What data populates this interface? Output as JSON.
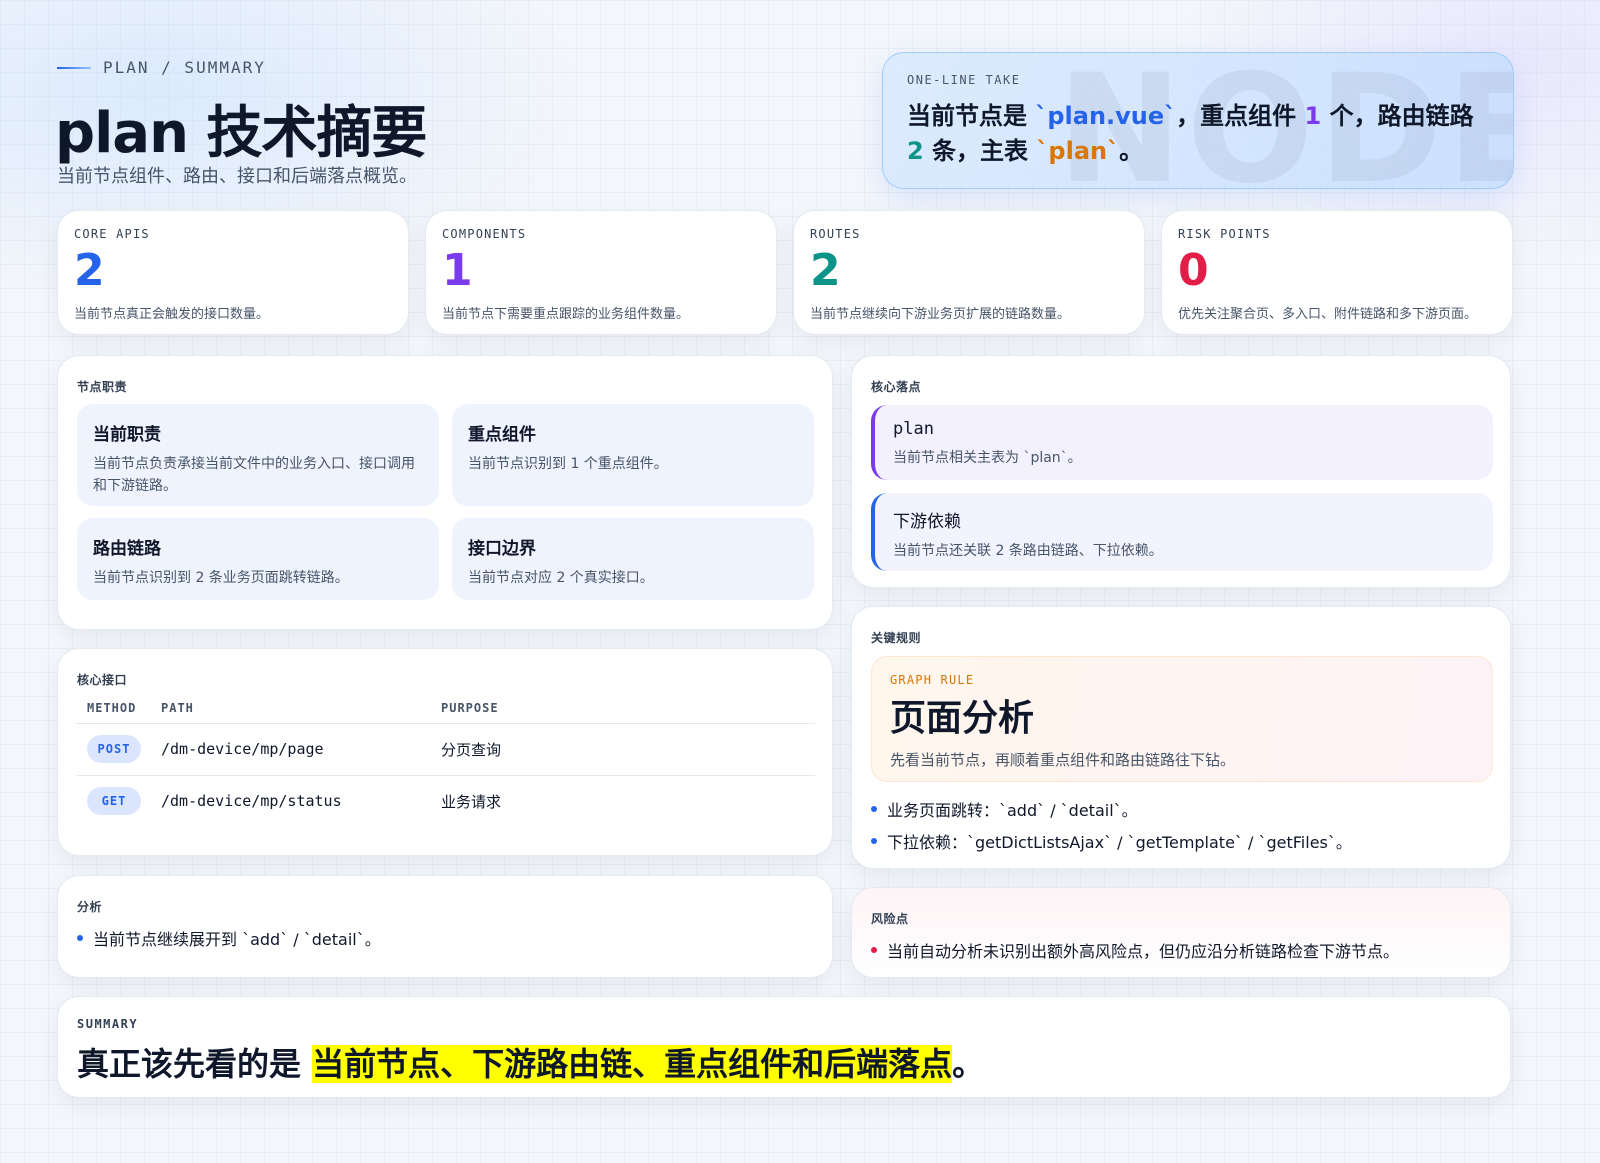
{
  "header": {
    "breadcrumb": "PLAN / SUMMARY",
    "title": "plan 技术摘要",
    "subtitle": "当前节点组件、路由、接口和后端落点概览。"
  },
  "take": {
    "label": "ONE-LINE TAKE",
    "watermark": "NODE",
    "parts": [
      "当前节点是 ",
      "`plan.vue`",
      "，重点组件 ",
      "1",
      " 个，路由链路 ",
      "2",
      " 条，主表 ",
      "`plan`",
      "。"
    ]
  },
  "stats": [
    {
      "label": "CORE APIS",
      "value": "2",
      "desc": "当前节点真正会触发的接口数量。",
      "color": "#2563eb"
    },
    {
      "label": "COMPONENTS",
      "value": "1",
      "desc": "当前节点下需要重点跟踪的业务组件数量。",
      "color": "#7c3aed"
    },
    {
      "label": "ROUTES",
      "value": "2",
      "desc": "当前节点继续向下游业务页扩展的链路数量。",
      "color": "#0d9488"
    },
    {
      "label": "RISK POINTS",
      "value": "0",
      "desc": "优先关注聚合页、多入口、附件链路和多下游页面。",
      "color": "#e11d48"
    }
  ],
  "duties": {
    "label": "节点职责",
    "items": [
      {
        "title": "当前职责",
        "desc": "当前节点负责承接当前文件中的业务入口、接口调用和下游链路。"
      },
      {
        "title": "重点组件",
        "desc": "当前节点识别到 1 个重点组件。"
      },
      {
        "title": "路由链路",
        "desc": "当前节点识别到 2 条业务页面跳转链路。"
      },
      {
        "title": "接口边界",
        "desc": "当前节点对应 2 个真实接口。"
      }
    ]
  },
  "apis": {
    "label": "核心接口",
    "columns": [
      "METHOD",
      "PATH",
      "PURPOSE"
    ],
    "rows": [
      {
        "method": "POST",
        "path": "/dm-device/mp/page",
        "purpose": "分页查询"
      },
      {
        "method": "GET",
        "path": "/dm-device/mp/status",
        "purpose": "业务请求"
      }
    ]
  },
  "analysis": {
    "label": "分析",
    "items": [
      "当前节点继续展开到 `add` / `detail`。"
    ]
  },
  "landing": {
    "label": "核心落点",
    "items": [
      {
        "title": "plan",
        "desc": "当前节点相关主表为 `plan`。"
      },
      {
        "title": "下游依赖",
        "desc": "当前节点还关联 2 条路由链路、下拉依赖。"
      }
    ]
  },
  "rules": {
    "label": "关键规则",
    "box_label": "GRAPH RULE",
    "box_title": "页面分析",
    "box_desc": "先看当前节点，再顺着重点组件和路由链路往下钻。",
    "items": [
      "业务页面跳转：`add` / `detail`。",
      "下拉依赖：`getDictListsAjax` / `getTemplate` / `getFiles`。"
    ]
  },
  "risks": {
    "label": "风险点",
    "items": [
      "当前自动分析未识别出额外高风险点，但仍应沿分析链路检查下游节点。"
    ]
  },
  "summary": {
    "label": "SUMMARY",
    "lead": "真正该先看的是 ",
    "highlight": "当前节点、下游路由链、重点组件和后端落点",
    "tail": "。"
  },
  "colors": {
    "accent_blue": "#2563eb",
    "accent_purple": "#7c3aed",
    "accent_green": "#0d9488",
    "accent_orange": "#d97706",
    "accent_red": "#e11d48",
    "highlight": "#ffff00"
  }
}
